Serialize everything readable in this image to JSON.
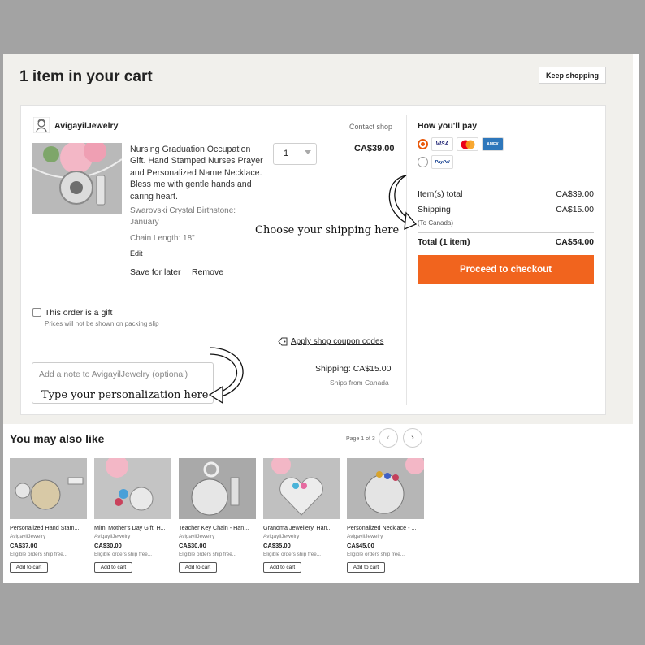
{
  "header": {
    "title": "1 item in your cart",
    "keep_shopping": "Keep shopping"
  },
  "shop": {
    "name": "AvigayilJewelry",
    "contact": "Contact shop"
  },
  "item": {
    "title": "Nursing Graduation Occupation Gift. Hand Stamped Nurses Prayer and Personalized Name Necklace. Bless me with gentle hands and caring heart.",
    "prop1_line1": "Swarovski Crystal Birthstone:",
    "prop1_line2": "January",
    "prop2": "Chain Length: 18\"",
    "edit": "Edit",
    "save_for_later": "Save for later",
    "remove": "Remove",
    "quantity": "1",
    "price": "CA$39.00"
  },
  "annotations": {
    "shipping": "Choose your shipping here",
    "personalization": "Type your personalization here"
  },
  "gift": {
    "label": "This order is a gift",
    "sub": "Prices will not be shown on packing slip"
  },
  "coupon": "Apply shop coupon codes",
  "shipping_line": {
    "total": "Shipping: CA$15.00",
    "from": "Ships from Canada"
  },
  "note": {
    "placeholder": "Add a note to AvigayilJewelry (optional)"
  },
  "payment": {
    "title": "How you'll pay",
    "cards": [
      "VISA",
      "",
      "AMEX"
    ],
    "paypal": "PayPal"
  },
  "summary": {
    "items_label": "Item(s) total",
    "items_value": "CA$39.00",
    "shipping_label": "Shipping",
    "shipping_value": "CA$15.00",
    "shipping_sub": "(To Canada)",
    "total_label": "Total (1 item)",
    "total_value": "CA$54.00",
    "checkout": "Proceed to checkout"
  },
  "colors": {
    "accent": "#f1641e",
    "radio": "#e95a0c",
    "page_bg": "#a3a3a3"
  },
  "recommendations": {
    "title": "You may also like",
    "page": "Page 1 of 3",
    "items": [
      {
        "title": "Personalized Hand Stam...",
        "shop": "AvigayilJewelry",
        "price": "CA$37.00",
        "ship": "Eligible orders ship free...",
        "button": "Add to cart"
      },
      {
        "title": "Mimi Mother's Day Gift. H...",
        "shop": "AvigayilJewelry",
        "price": "CA$30.00",
        "ship": "Eligible orders ship free...",
        "button": "Add to cart"
      },
      {
        "title": "Teacher Key Chain - Han...",
        "shop": "AvigayilJewelry",
        "price": "CA$30.00",
        "ship": "Eligible orders ship free...",
        "button": "Add to cart"
      },
      {
        "title": "Grandma Jewellery. Han...",
        "shop": "AvigayilJewelry",
        "price": "CA$35.00",
        "ship": "Eligible orders ship free...",
        "button": "Add to cart"
      },
      {
        "title": "Personalized Necklace - ...",
        "shop": "AvigayilJewelry",
        "price": "CA$45.00",
        "ship": "Eligible orders ship free...",
        "button": "Add to cart"
      }
    ]
  }
}
